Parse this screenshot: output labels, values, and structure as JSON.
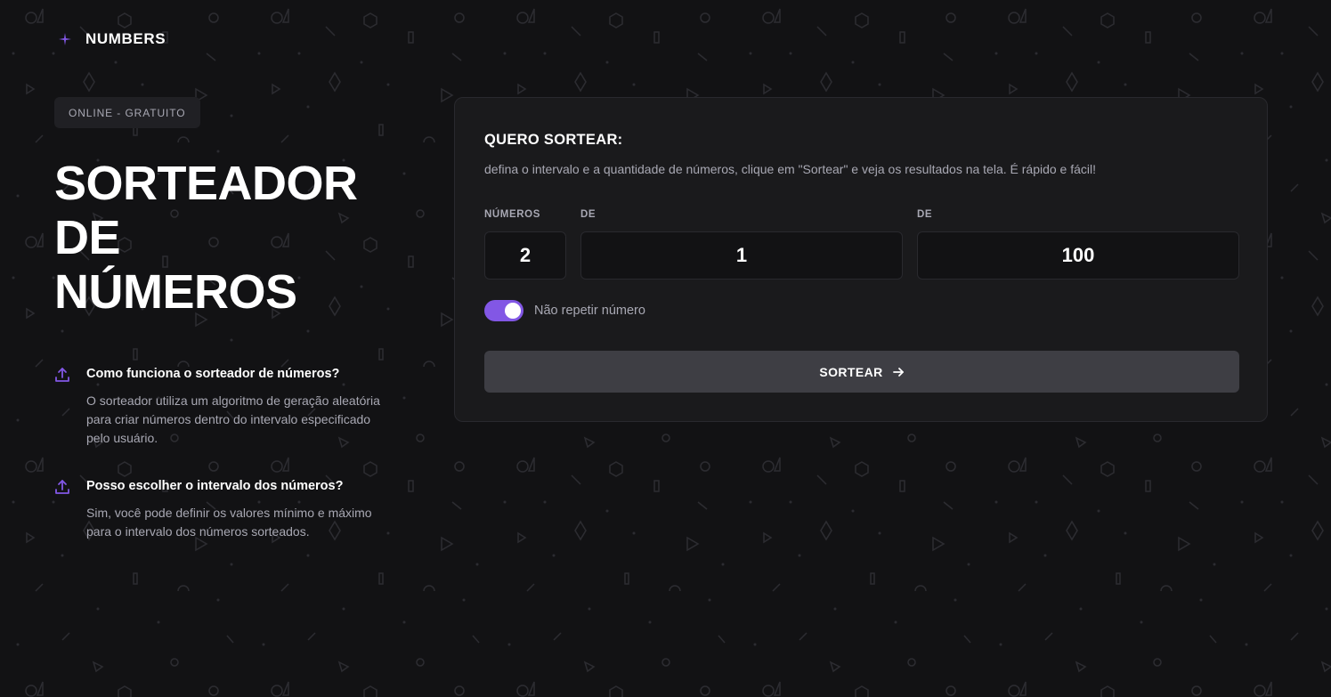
{
  "brand": {
    "name": "NUMBERS"
  },
  "badge": "ONLINE - GRATUITO",
  "hero": {
    "title_lines": [
      "SORTEADOR",
      "DE",
      "NÚMEROS"
    ]
  },
  "faq": [
    {
      "question": "Como funciona o sorteador de números?",
      "answer": "O sorteador utiliza um algoritmo de geração aleatória para criar números dentro do intervalo especificado pelo usuário.",
      "icon": "upload-icon"
    },
    {
      "question": "Posso escolher o intervalo dos números?",
      "answer": "Sim, você pode definir os valores mínimo e máximo para o intervalo dos números sorteados.",
      "icon": "upload-icon"
    }
  ],
  "form": {
    "title": "QUERO SORTEAR:",
    "description": "defina o intervalo e a quantidade de números, clique em \"Sortear\" e veja os resultados na tela. É rápido e fácil!",
    "fields": [
      {
        "label": "NÚMEROS",
        "value": "2"
      },
      {
        "label": "DE",
        "value": "1"
      },
      {
        "label": "DE",
        "value": "100"
      }
    ],
    "toggle": {
      "label": "Não repetir número",
      "checked": true
    },
    "submit_label": "SORTEAR"
  },
  "colors": {
    "background": "#121214",
    "card": "#1a1a1c",
    "accent": "#8257e5",
    "button": "#3e3e44"
  }
}
